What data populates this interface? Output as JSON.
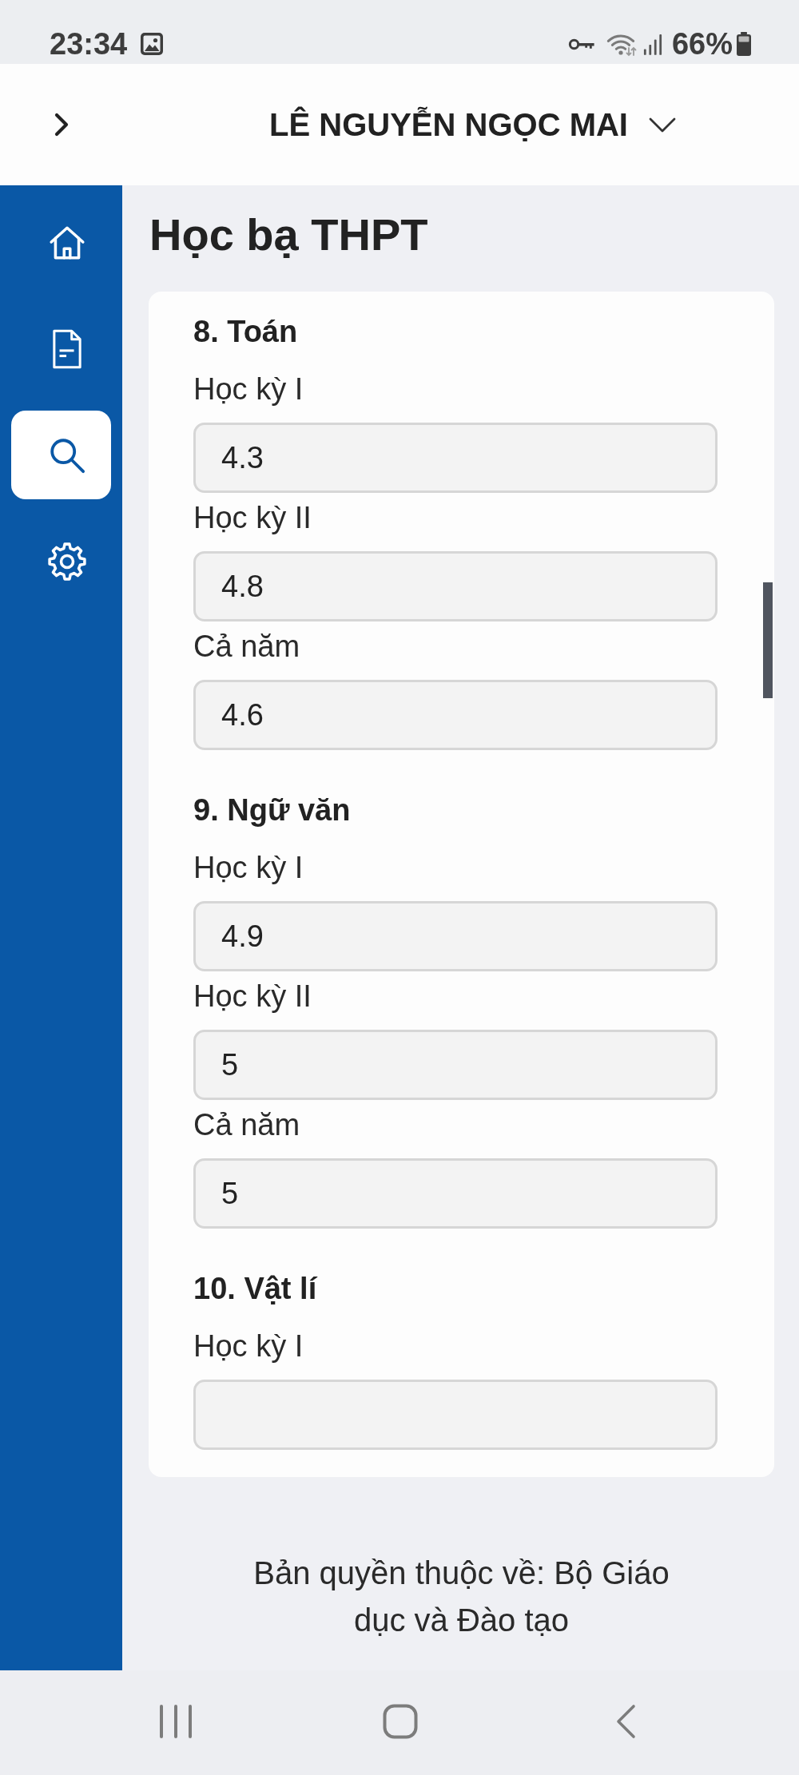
{
  "status_bar": {
    "time": "23:34",
    "battery": "66%"
  },
  "header": {
    "user_name": "LÊ NGUYỄN NGỌC MAI"
  },
  "sidebar": {
    "items": [
      {
        "kind": "home",
        "selected": false
      },
      {
        "kind": "document",
        "selected": false
      },
      {
        "kind": "search",
        "selected": true
      },
      {
        "kind": "settings",
        "selected": false
      }
    ]
  },
  "page": {
    "title": "Học bạ THPT"
  },
  "subjects": [
    {
      "heading": "8. Toán",
      "fields": [
        {
          "label": "Học kỳ I",
          "value": "4.3"
        },
        {
          "label": "Học kỳ II",
          "value": "4.8"
        },
        {
          "label": "Cả năm",
          "value": "4.6"
        }
      ]
    },
    {
      "heading": "9. Ngữ văn",
      "fields": [
        {
          "label": "Học kỳ I",
          "value": "4.9"
        },
        {
          "label": "Học kỳ II",
          "value": "5"
        },
        {
          "label": "Cả năm",
          "value": "5"
        }
      ]
    },
    {
      "heading": "10. Vật lí",
      "fields": [
        {
          "label": "Học kỳ I"
        }
      ]
    }
  ],
  "footer": {
    "text": "Bản quyền thuộc về: Bộ Giáo dục và Đào tạo"
  }
}
